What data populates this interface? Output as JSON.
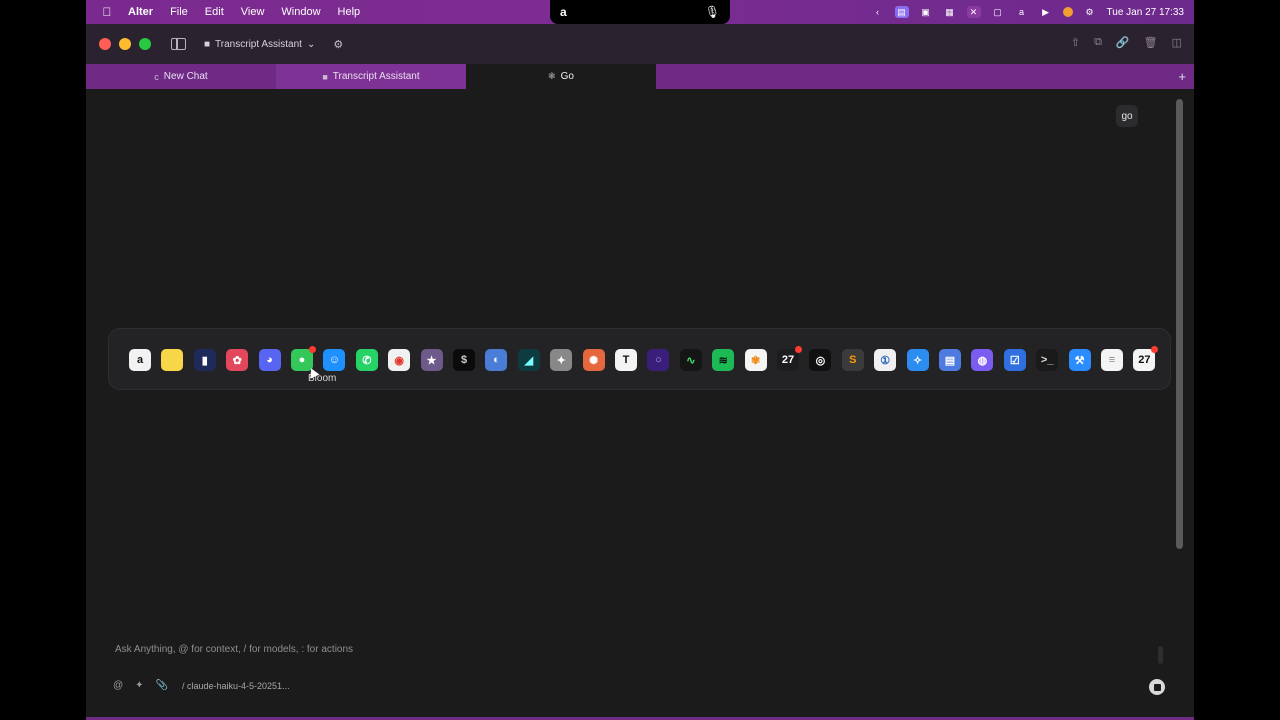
{
  "menubar": {
    "app": "Alter",
    "items": [
      "File",
      "Edit",
      "View",
      "Window",
      "Help"
    ],
    "clock": "Tue Jan 27  17:33"
  },
  "titlebar": {
    "workspace": "Transcript Assistant"
  },
  "tabs": [
    {
      "label": "New Chat",
      "icon": "c-icon"
    },
    {
      "label": "Transcript Assistant",
      "icon": "folder-icon"
    },
    {
      "label": "Go",
      "icon": "spinner-icon"
    }
  ],
  "main": {
    "go_chip": "go",
    "dock_tooltip": "Bloom"
  },
  "dock": {
    "apps": [
      {
        "name": "alter",
        "glyph": "a",
        "bg": "#f2f2f2",
        "fg": "#111"
      },
      {
        "name": "notes",
        "glyph": "",
        "bg": "#f7d64a",
        "fg": "#111"
      },
      {
        "name": "screen-capture",
        "glyph": "▮",
        "bg": "#1e2a5a",
        "fg": "#fff"
      },
      {
        "name": "bloom",
        "glyph": "✿",
        "bg": "#e2475b",
        "fg": "#fff"
      },
      {
        "name": "discord",
        "glyph": "◕",
        "bg": "#5865f2",
        "fg": "#fff"
      },
      {
        "name": "messages",
        "glyph": "●",
        "bg": "#34c759",
        "fg": "#fff",
        "badge": true
      },
      {
        "name": "finder",
        "glyph": "☺",
        "bg": "#1e90ff",
        "fg": "#fff"
      },
      {
        "name": "whatsapp",
        "glyph": "✆",
        "bg": "#25d366",
        "fg": "#fff"
      },
      {
        "name": "chrome",
        "glyph": "◉",
        "bg": "#f1f1f1",
        "fg": "#e0392b"
      },
      {
        "name": "affinity",
        "glyph": "★",
        "bg": "#6e5a8a",
        "fg": "#fff"
      },
      {
        "name": "terminal-dark",
        "glyph": "$",
        "bg": "#0b0b0b",
        "fg": "#ccc"
      },
      {
        "name": "preview",
        "glyph": "◐",
        "bg": "#4a7dd8",
        "fg": "#fff"
      },
      {
        "name": "perplexity",
        "glyph": "◢",
        "bg": "#0e3b3f",
        "fg": "#7ff"
      },
      {
        "name": "utility",
        "glyph": "✦",
        "bg": "#888",
        "fg": "#fff"
      },
      {
        "name": "claude",
        "glyph": "✺",
        "bg": "#e5673d",
        "fg": "#fff"
      },
      {
        "name": "typora",
        "glyph": "T",
        "bg": "#f4f4f4",
        "fg": "#111"
      },
      {
        "name": "orbit",
        "glyph": "○",
        "bg": "#3a1f7a",
        "fg": "#b69cff"
      },
      {
        "name": "activity",
        "glyph": "∿",
        "bg": "#151515",
        "fg": "#3ee06b"
      },
      {
        "name": "spotify",
        "glyph": "≋",
        "bg": "#1db954",
        "fg": "#111"
      },
      {
        "name": "photos",
        "glyph": "✾",
        "bg": "#f5f5f5",
        "fg": "#ef8d1f"
      },
      {
        "name": "calendar-a",
        "glyph": "27",
        "bg": "#1c1c1e",
        "fg": "#fff",
        "badge": true
      },
      {
        "name": "chatgpt",
        "glyph": "◎",
        "bg": "#111",
        "fg": "#fff"
      },
      {
        "name": "sublime",
        "glyph": "S",
        "bg": "#3b3b3b",
        "fg": "#ff9800"
      },
      {
        "name": "1password",
        "glyph": "①",
        "bg": "#f0f0f0",
        "fg": "#1f5fbf"
      },
      {
        "name": "safari",
        "glyph": "✧",
        "bg": "#2d8cf0",
        "fg": "#fff"
      },
      {
        "name": "readdle",
        "glyph": "▤",
        "bg": "#4d7be0",
        "fg": "#fff"
      },
      {
        "name": "proton",
        "glyph": "◍",
        "bg": "#7a5cf0",
        "fg": "#fff"
      },
      {
        "name": "tasks",
        "glyph": "☑",
        "bg": "#2f6fe0",
        "fg": "#fff"
      },
      {
        "name": "terminal",
        "glyph": ">_",
        "bg": "#1a1a1a",
        "fg": "#ddd"
      },
      {
        "name": "xcode",
        "glyph": "⚒",
        "bg": "#2b8cff",
        "fg": "#fff"
      },
      {
        "name": "textedit",
        "glyph": "≡",
        "bg": "#f4f4f4",
        "fg": "#888"
      },
      {
        "name": "calendar-b",
        "glyph": "27",
        "bg": "#f4f4f4",
        "fg": "#111",
        "badge": true
      }
    ]
  },
  "input": {
    "placeholder": "Ask Anything, @ for context, / for models, : for actions",
    "model": "/ claude-haiku-4-5-20251..."
  }
}
